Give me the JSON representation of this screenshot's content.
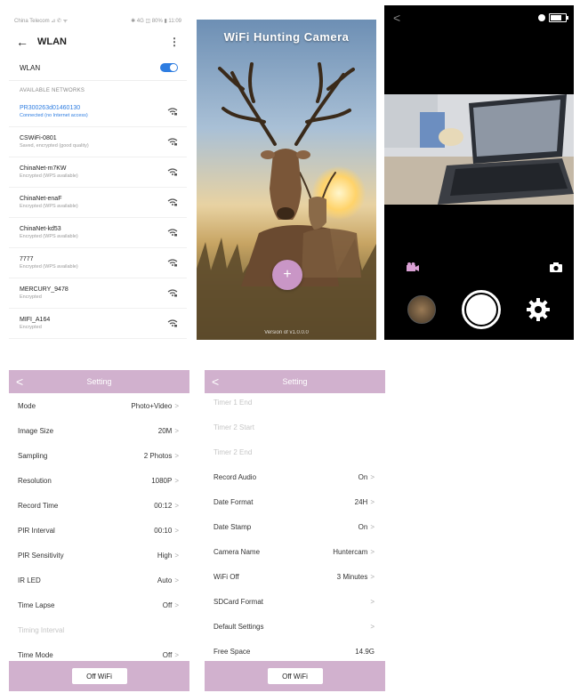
{
  "wlan": {
    "status_left": "China Telecom ⊿ ✆ ᯤ",
    "status_right": "✱ 4G ◫ 80% ▮ 11:09",
    "back": "←",
    "title": "WLAN",
    "more": "⋮",
    "wlan_label": "WLAN",
    "section_title": "AVAILABLE NETWORKS",
    "networks": [
      {
        "name": "PR300263d01460130",
        "status": "Connected (no Internet access)"
      },
      {
        "name": "CSWiFi-0801",
        "status": "Saved, encrypted (good quality)"
      },
      {
        "name": "ChinaNet-m7KW",
        "status": "Encrypted (WPS available)"
      },
      {
        "name": "ChinaNet-enaF",
        "status": "Encrypted (WPS available)"
      },
      {
        "name": "ChinaNet-kd53",
        "status": "Encrypted (WPS available)"
      },
      {
        "name": "7777",
        "status": "Encrypted (WPS available)"
      },
      {
        "name": "MERCURY_9478",
        "status": "Encrypted"
      },
      {
        "name": "MIFI_A164",
        "status": "Encrypted"
      }
    ]
  },
  "splash": {
    "title": "WiFi Hunting Camera",
    "fab": "+",
    "version": "Version of  v1.0.0.0"
  },
  "camera": {
    "back": "<"
  },
  "settings1": {
    "back": "<",
    "title": "Setting",
    "rows": [
      {
        "label": "Mode",
        "value": "Photo+Video"
      },
      {
        "label": "Image Size",
        "value": "20M"
      },
      {
        "label": "Sampling",
        "value": "2 Photos"
      },
      {
        "label": "Resolution",
        "value": "1080P"
      },
      {
        "label": "Record Time",
        "value": "00:12"
      },
      {
        "label": "PIR Interval",
        "value": "00:10"
      },
      {
        "label": "PIR Sensitivity",
        "value": "High"
      },
      {
        "label": "IR LED",
        "value": "Auto"
      },
      {
        "label": "Time Lapse",
        "value": "Off"
      },
      {
        "label": "Timing Interval",
        "value": ""
      },
      {
        "label": "Time Mode",
        "value": "Off"
      }
    ],
    "footer_button": "Off WiFi"
  },
  "settings2": {
    "back": "<",
    "title": "Setting",
    "rows": [
      {
        "label": "Timer 1 End",
        "value": ""
      },
      {
        "label": "Timer 2 Start",
        "value": ""
      },
      {
        "label": "Timer 2 End",
        "value": ""
      },
      {
        "label": "Record Audio",
        "value": "On"
      },
      {
        "label": "Date Format",
        "value": "24H"
      },
      {
        "label": "Date Stamp",
        "value": "On"
      },
      {
        "label": "Camera Name",
        "value": "Huntercam"
      },
      {
        "label": "WiFi Off",
        "value": "3 Minutes"
      },
      {
        "label": "SDCard Format",
        "value": ""
      },
      {
        "label": "Default Settings",
        "value": ""
      },
      {
        "label": "Free Space",
        "value": "14.9G"
      }
    ],
    "footer_button": "Off WiFi"
  },
  "chevron": ">",
  "colors": {
    "accent_blue": "#2e7de1",
    "settings_pink": "#d1b1ce",
    "fab_pink": "#c996c6"
  }
}
